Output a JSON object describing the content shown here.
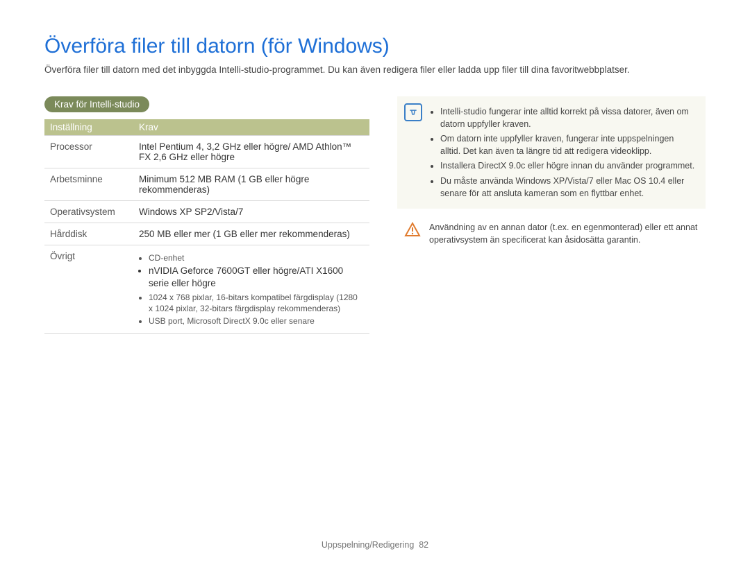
{
  "title": "Överföra filer till datorn (för Windows)",
  "intro": "Överföra filer till datorn med det inbyggda Intelli-studio-programmet. Du kan även redigera filer eller ladda upp filer till dina favoritwebbplatser.",
  "subheader": "Krav för Intelli-studio",
  "table": {
    "headers": {
      "col1": "Inställning",
      "col2": "Krav"
    },
    "rows": {
      "processor": {
        "label": "Processor",
        "value": "Intel Pentium 4, 3,2 GHz eller högre/\nAMD Athlon™ FX 2,6 GHz eller högre"
      },
      "ram": {
        "label": "Arbetsminne",
        "value": "Minimum 512 MB RAM (1 GB eller högre rekommenderas)"
      },
      "os": {
        "label": "Operativsystem",
        "value": "Windows XP SP2/Vista/7"
      },
      "hdd": {
        "label": "Hårddisk",
        "value": "250 MB eller mer (1 GB eller mer rekommenderas)"
      },
      "other": {
        "label": "Övrigt",
        "items": {
          "i0": "CD-enhet",
          "i1": "nVIDIA Geforce 7600GT eller högre/ATI X1600 serie eller högre",
          "i2": "1024 x 768 pixlar, 16-bitars kompatibel färgdisplay (1280 x 1024 pixlar, 32-bitars färgdisplay rekommenderas)",
          "i3": "USB port, Microsoft DirectX 9.0c eller senare"
        }
      }
    }
  },
  "note": {
    "n0": "Intelli-studio fungerar inte alltid korrekt på vissa datorer, även om datorn uppfyller kraven.",
    "n1": "Om datorn inte uppfyller kraven, fungerar inte uppspelningen alltid. Det kan även ta längre tid att redigera videoklipp.",
    "n2": "Installera DirectX 9.0c eller högre innan du använder programmet.",
    "n3": "Du måste använda Windows XP/Vista/7 eller Mac OS 10.4 eller senare för att ansluta kameran som en flyttbar enhet."
  },
  "warning": "Användning av en annan dator (t.ex. en egenmonterad) eller ett annat operativsystem än specificerat kan åsidosätta garantin.",
  "footer": {
    "section": "Uppspelning/Redigering",
    "page": "82"
  }
}
